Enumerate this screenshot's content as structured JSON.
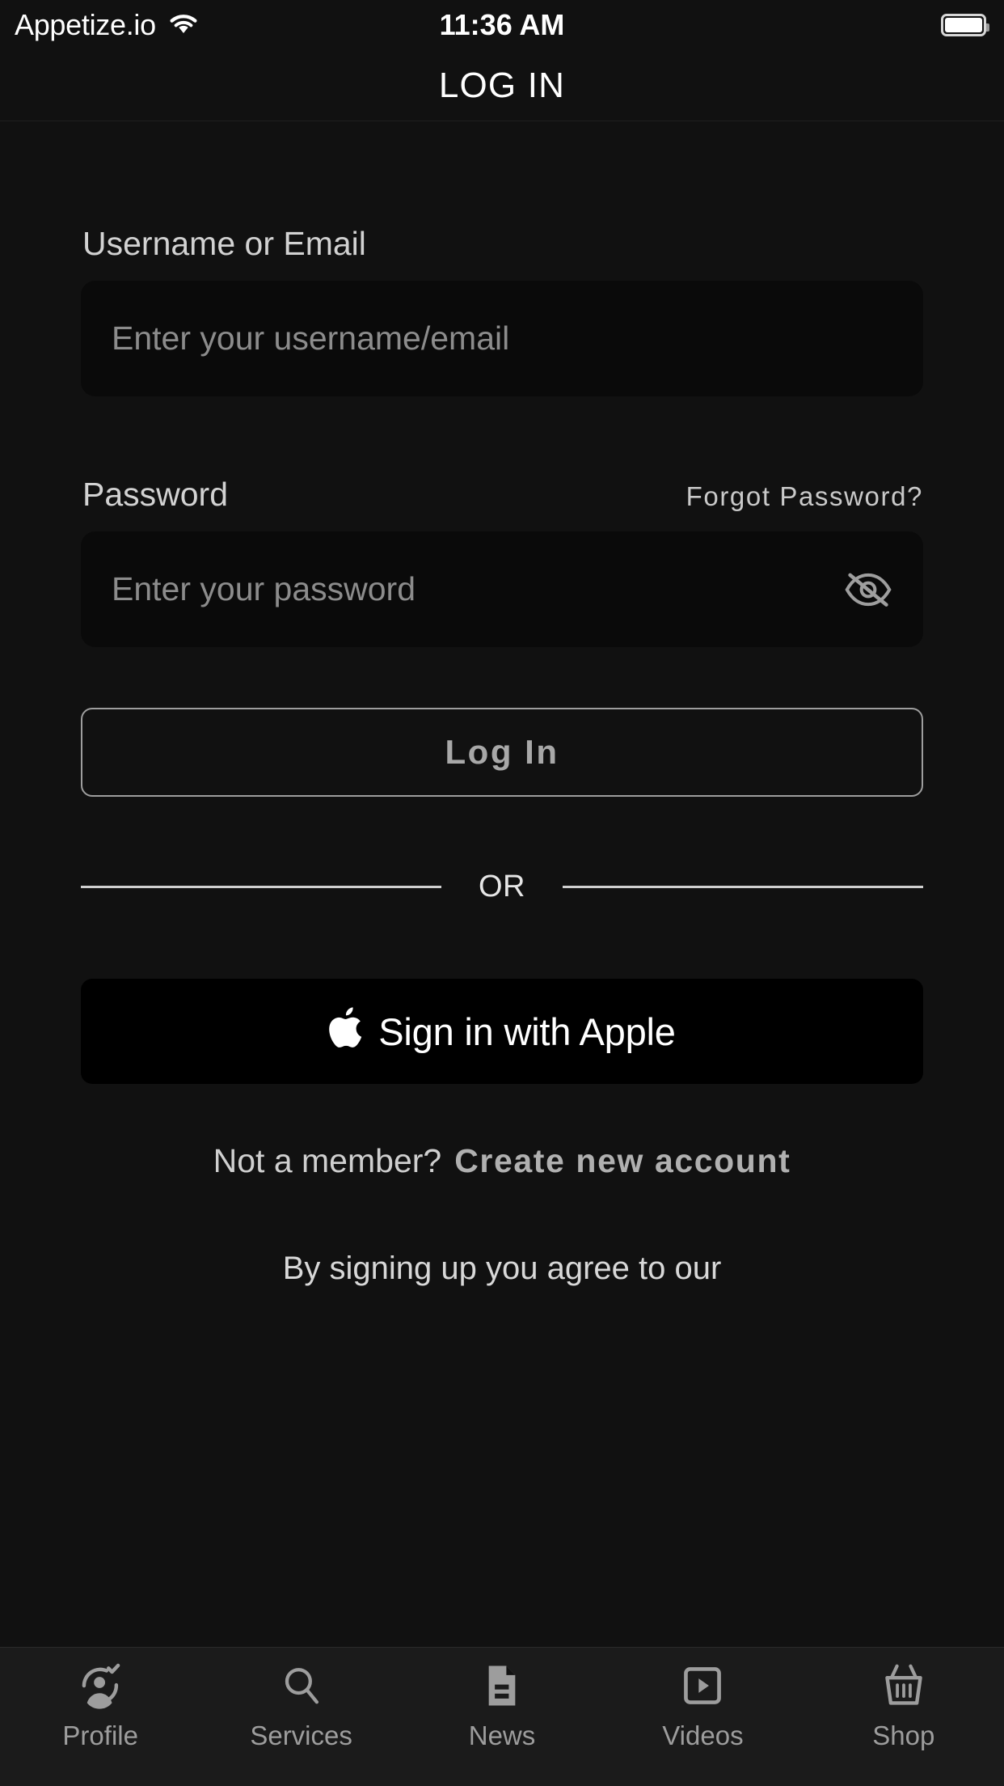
{
  "status_bar": {
    "carrier": "Appetize.io",
    "wifi_icon": "wifi-icon",
    "time": "11:36 AM",
    "battery_icon": "battery-full-icon"
  },
  "nav": {
    "title": "LOG IN"
  },
  "form": {
    "username": {
      "label": "Username or Email",
      "placeholder": "Enter your username/email",
      "value": ""
    },
    "password": {
      "label": "Password",
      "forgot_label": "Forgot Password?",
      "placeholder": "Enter your password",
      "value": "",
      "visibility_icon": "eye-off-icon"
    },
    "login_button": "Log In",
    "divider_text": "OR",
    "apple_button": {
      "label": "Sign in with Apple",
      "icon": "apple-logo-icon"
    },
    "signup": {
      "question": "Not a member?",
      "link": "Create new account"
    },
    "terms": "By signing up you agree to our"
  },
  "tab_bar": {
    "items": [
      {
        "label": "Profile",
        "icon": "user-check-icon"
      },
      {
        "label": "Services",
        "icon": "search-icon"
      },
      {
        "label": "News",
        "icon": "document-icon"
      },
      {
        "label": "Videos",
        "icon": "video-play-icon"
      },
      {
        "label": "Shop",
        "icon": "shopping-basket-icon"
      }
    ]
  },
  "colors": {
    "background": "#111111",
    "input_background": "#0a0a0a",
    "apple_button_background": "#000000",
    "tab_bar_background": "#1b1b1b",
    "primary_text": "#ffffff",
    "secondary_text": "#b0b0b0",
    "placeholder_text": "#8c8c8c"
  }
}
